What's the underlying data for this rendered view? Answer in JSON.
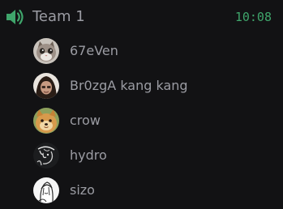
{
  "channel": {
    "name": "Team 1",
    "time": "10:08",
    "icon": "voice-speaker-icon",
    "accent_color": "#3fa56b",
    "text_color": "#9b9ca3",
    "background_color": "#121214"
  },
  "members": [
    {
      "name": "67eVen",
      "avatar": "cat-photo-avatar"
    },
    {
      "name": "Br0zgA kang kang",
      "avatar": "person-photo-avatar"
    },
    {
      "name": "crow",
      "avatar": "dog-photo-avatar"
    },
    {
      "name": "hydro",
      "avatar": "sketch-avatar"
    },
    {
      "name": "sizo",
      "avatar": "anime-sketch-avatar"
    }
  ]
}
